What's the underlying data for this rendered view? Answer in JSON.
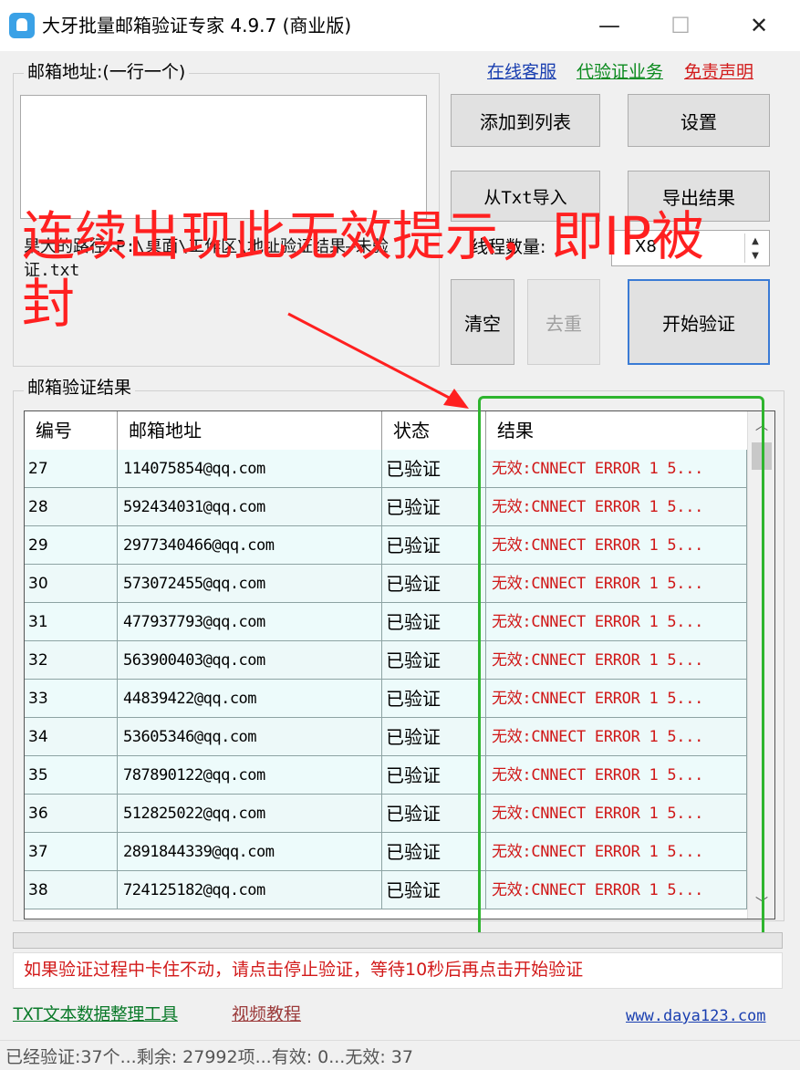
{
  "window": {
    "title": "大牙批量邮箱验证专家 4.9.7 (商业版)",
    "min_glyph": "—",
    "max_glyph": "☐",
    "close_glyph": "✕"
  },
  "email_section": {
    "label": "邮箱地址:(一行一个)",
    "textarea_value": ""
  },
  "links": {
    "service": "在线客服",
    "proxy": "代验证业务",
    "disclaimer": "免责声明",
    "txt_tool": "TXT文本数据整理工具",
    "video": "视频教程",
    "site": "www.daya123.com"
  },
  "buttons": {
    "add": "添加到列表",
    "settings": "设置",
    "import": "从Txt导入",
    "export": "导出结果",
    "clear": "清空",
    "dedup": "去重",
    "start": "开始验证"
  },
  "path_text": "果大的路径:P:\\桌面\\工作区\\地址验证结果—未验证.txt",
  "threads": {
    "label": "线程数量:",
    "value": "X8"
  },
  "overlay": {
    "text": "连续出现此无效提示，即IP被封"
  },
  "results": {
    "label": "邮箱验证结果",
    "columns": [
      "编号",
      "邮箱地址",
      "状态",
      "结果"
    ],
    "rows": [
      {
        "id": "27",
        "email": "114075854@qq.com",
        "status": "已验证",
        "result": "无效:CNNECT ERROR 1 5..."
      },
      {
        "id": "28",
        "email": "592434031@qq.com",
        "status": "已验证",
        "result": "无效:CNNECT ERROR 1 5..."
      },
      {
        "id": "29",
        "email": "2977340466@qq.com",
        "status": "已验证",
        "result": "无效:CNNECT ERROR 1 5..."
      },
      {
        "id": "30",
        "email": "573072455@qq.com",
        "status": "已验证",
        "result": "无效:CNNECT ERROR 1 5..."
      },
      {
        "id": "31",
        "email": "477937793@qq.com",
        "status": "已验证",
        "result": "无效:CNNECT ERROR 1 5..."
      },
      {
        "id": "32",
        "email": "563900403@qq.com",
        "status": "已验证",
        "result": "无效:CNNECT ERROR 1 5..."
      },
      {
        "id": "33",
        "email": "44839422@qq.com",
        "status": "已验证",
        "result": "无效:CNNECT ERROR 1 5..."
      },
      {
        "id": "34",
        "email": "53605346@qq.com",
        "status": "已验证",
        "result": "无效:CNNECT ERROR 1 5..."
      },
      {
        "id": "35",
        "email": "787890122@qq.com",
        "status": "已验证",
        "result": "无效:CNNECT ERROR 1 5..."
      },
      {
        "id": "36",
        "email": "512825022@qq.com",
        "status": "已验证",
        "result": "无效:CNNECT ERROR 1 5..."
      },
      {
        "id": "37",
        "email": "2891844339@qq.com",
        "status": "已验证",
        "result": "无效:CNNECT ERROR 1 5..."
      },
      {
        "id": "38",
        "email": "724125182@qq.com",
        "status": "已验证",
        "result": "无效:CNNECT ERROR 1 5..."
      }
    ]
  },
  "warning": "如果验证过程中卡住不动，请点击停止验证，等待10秒后再点击开始验证",
  "status_bar": "已经验证:37个...剩余: 27992项...有效: 0...无效: 37",
  "colors": {
    "accent_blue": "#3a7bd5",
    "link_green": "#0b8a1e",
    "error_red": "#d01818",
    "annotation_green": "#2fb52f",
    "annotation_red": "#ff2020"
  },
  "icons": {
    "app": "tooth-logo-icon",
    "spinner_up": "▲",
    "spinner_down": "▼",
    "scroll_up": "︿",
    "scroll_down": "﹀"
  }
}
